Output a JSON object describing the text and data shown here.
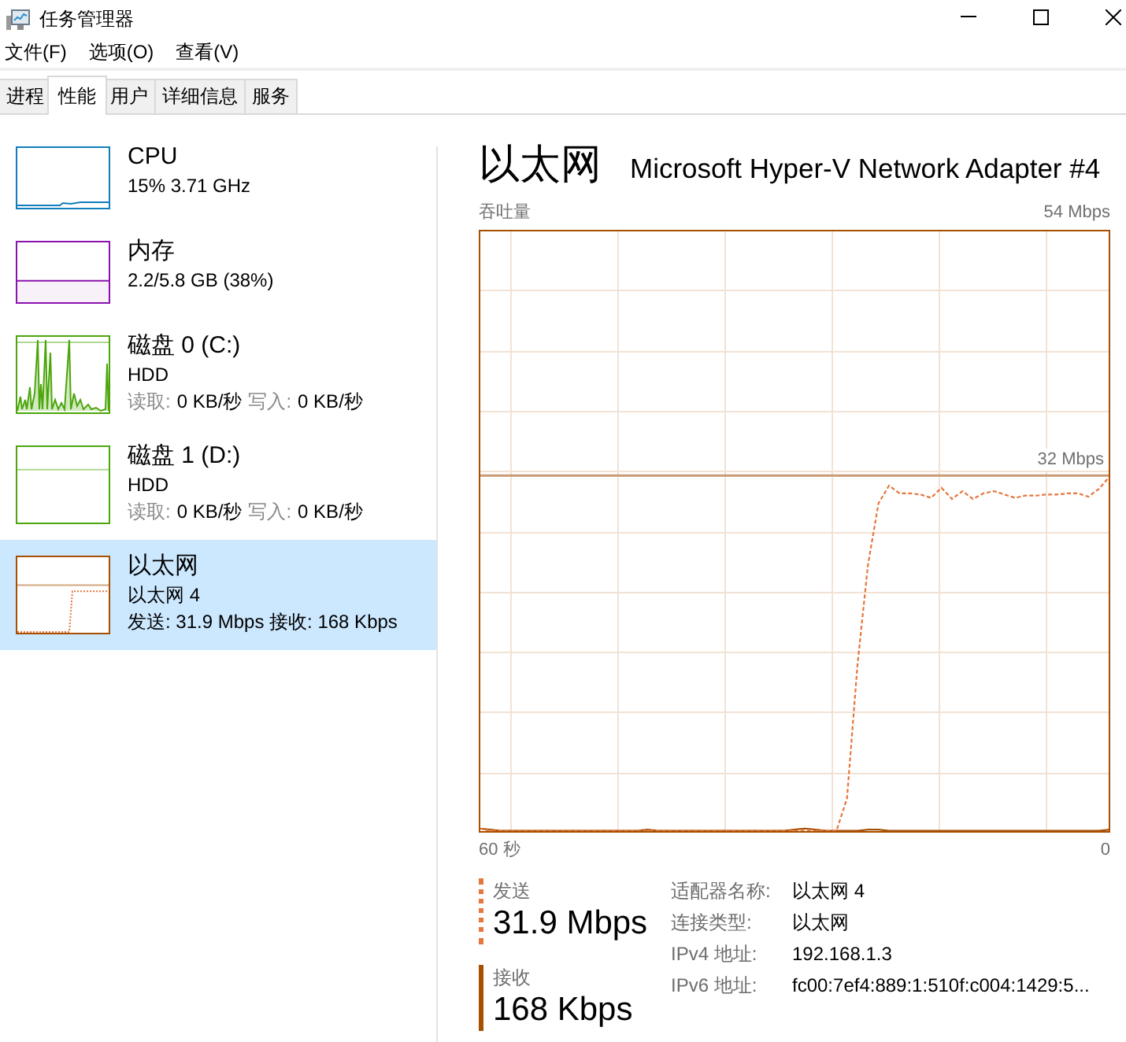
{
  "window": {
    "title": "任务管理器"
  },
  "menu": [
    {
      "label": "文件(F)"
    },
    {
      "label": "选项(O)"
    },
    {
      "label": "查看(V)"
    }
  ],
  "tabs": [
    {
      "label": "进程",
      "selected": false
    },
    {
      "label": "性能",
      "selected": true
    },
    {
      "label": "用户",
      "selected": false
    },
    {
      "label": "详细信息",
      "selected": false
    },
    {
      "label": "服务",
      "selected": false
    }
  ],
  "sidebar": {
    "items": [
      {
        "title": "CPU",
        "kind": "line",
        "color": "#117dbb",
        "selected": false,
        "lines": [
          "15% 3.71 GHz"
        ]
      },
      {
        "title": "内存",
        "kind": "fill",
        "color": "#8b12ae",
        "selected": false,
        "lines": [
          "2.2/5.8 GB (38%)"
        ]
      },
      {
        "title": "磁盘 0 (C:)",
        "kind": "spikes",
        "color": "#4da60c",
        "selected": false,
        "lines": [
          "HDD"
        ],
        "stats": [
          {
            "label": "读取:",
            "value": "0 KB/秒"
          },
          {
            "label": "写入:",
            "value": "0 KB/秒"
          }
        ]
      },
      {
        "title": "磁盘 1 (D:)",
        "kind": "flat",
        "color": "#4da60c",
        "selected": false,
        "lines": [
          "HDD"
        ],
        "stats": [
          {
            "label": "读取:",
            "value": "0 KB/秒"
          },
          {
            "label": "写入:",
            "value": "0 KB/秒"
          }
        ]
      },
      {
        "title": "以太网",
        "kind": "step",
        "color": "#a74f01",
        "selected": true,
        "lines": [
          "以太网 4",
          "发送: 31.9 Mbps 接收: 168 Kbps"
        ]
      }
    ]
  },
  "detail": {
    "title": "以太网",
    "subtitle": "Microsoft Hyper-V Network Adapter #4",
    "graph": {
      "title": "吞吐量",
      "max_label": "54 Mbps",
      "scale_label": "32 Mbps",
      "time_start": "60 秒",
      "time_end": "0"
    },
    "stats": [
      {
        "kind": "dashed",
        "color": "#e5763c",
        "label": "发送",
        "value": "31.9 Mbps"
      },
      {
        "kind": "solid",
        "color": "#a74f01",
        "label": "接收",
        "value": "168 Kbps"
      }
    ],
    "properties": [
      {
        "label": "适配器名称:",
        "value": "以太网 4"
      },
      {
        "label": "连接类型:",
        "value": "以太网"
      },
      {
        "label": "IPv4 地址:",
        "value": "192.168.1.3"
      },
      {
        "label": "IPv6 地址:",
        "value": "fc00:7ef4:889:1:510f:c004:1429:5..."
      }
    ]
  }
}
